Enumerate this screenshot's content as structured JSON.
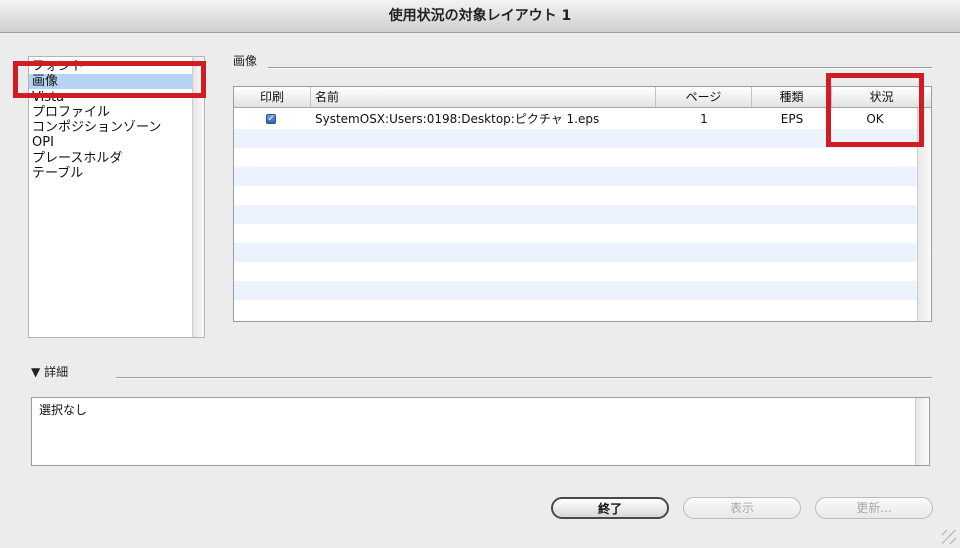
{
  "window": {
    "title": "使用状況の対象レイアウト 1"
  },
  "sidebar": {
    "items": [
      {
        "label": "フォント",
        "selected": false
      },
      {
        "label": "画像",
        "selected": true
      },
      {
        "label": "Vista",
        "selected": false
      },
      {
        "label": "プロファイル",
        "selected": false
      },
      {
        "label": "コンポジションゾーン",
        "selected": false
      },
      {
        "label": "OPI",
        "selected": false
      },
      {
        "label": "プレースホルダ",
        "selected": false
      },
      {
        "label": "テーブル",
        "selected": false
      }
    ]
  },
  "images_group": {
    "label": "画像"
  },
  "table": {
    "columns": {
      "print": "印刷",
      "name": "名前",
      "page": "ページ",
      "type": "種類",
      "status": "状況"
    },
    "rows": [
      {
        "print_checked": true,
        "name": "SystemOSX:Users:0198:Desktop:ピクチャ 1.eps",
        "page": "1",
        "type": "EPS",
        "status": "OK"
      }
    ]
  },
  "details": {
    "toggle": "▼",
    "label": "詳細",
    "text": "選択なし"
  },
  "buttons": {
    "done": "終了",
    "show": "表示",
    "update": "更新..."
  },
  "colors": {
    "highlight_box": "#d21c24",
    "selection": "#b6d3f3",
    "row_stripe": "#edf3fe",
    "checkbox": "#2e63b5"
  }
}
